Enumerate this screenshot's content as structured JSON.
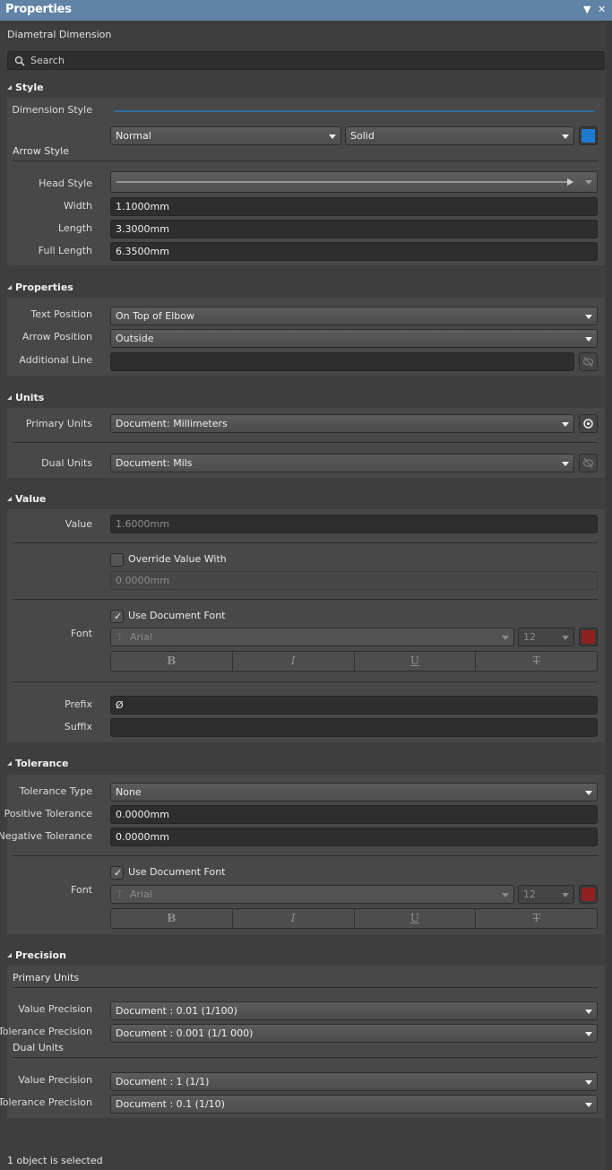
{
  "window": {
    "title": "Properties",
    "menu_icon": "dropdown-triangle-icon",
    "close_icon": "close-icon"
  },
  "object_type": "Diametral Dimension",
  "search": {
    "placeholder": "Search",
    "value": ""
  },
  "sections": {
    "style": {
      "header": "Style",
      "dimension_style_label": "Dimension Style",
      "line_color": "#2f6f9f",
      "line_type": "Normal",
      "line_pattern": "Solid",
      "color_swatch": "#1c7bd0",
      "arrow_style_header": "Arrow Style",
      "head_style_label": "Head Style",
      "width_label": "Width",
      "width_value": "1.1000mm",
      "length_label": "Length",
      "length_value": "3.3000mm",
      "full_length_label": "Full Length",
      "full_length_value": "6.3500mm"
    },
    "properties": {
      "header": "Properties",
      "text_position_label": "Text Position",
      "text_position_value": "On Top of Elbow",
      "arrow_position_label": "Arrow Position",
      "arrow_position_value": "Outside",
      "additional_line_label": "Additional Line",
      "additional_line_value": ""
    },
    "units": {
      "header": "Units",
      "primary_units_label": "Primary Units",
      "primary_units_value": "Document: Millimeters",
      "dual_units_label": "Dual Units",
      "dual_units_value": "Document: Mils"
    },
    "value": {
      "header": "Value",
      "value_label": "Value",
      "value_value": "1.6000mm",
      "override_label": "Override Value With",
      "override_checked": false,
      "override_value": "0.0000mm",
      "use_doc_font_label": "Use Document Font",
      "use_doc_font_checked": true,
      "font_label": "Font",
      "font_name": "Arial",
      "font_size": "12",
      "font_color": "#8f2020",
      "bold_label": "B",
      "italic_label": "I",
      "underline_label": "U",
      "strike_label": "T",
      "prefix_label": "Prefix",
      "prefix_value": "Ø",
      "suffix_label": "Suffix",
      "suffix_value": ""
    },
    "tolerance": {
      "header": "Tolerance",
      "type_label": "Tolerance Type",
      "type_value": "None",
      "positive_label": "Positive Tolerance",
      "positive_value": "0.0000mm",
      "negative_label": "Negative Tolerance",
      "negative_value": "0.0000mm",
      "use_doc_font_label": "Use Document Font",
      "use_doc_font_checked": true,
      "font_label": "Font",
      "font_name": "Arial",
      "font_size": "12",
      "font_color": "#8f2020",
      "bold_label": "B",
      "italic_label": "I",
      "underline_label": "U",
      "strike_label": "T"
    },
    "precision": {
      "header": "Precision",
      "primary_units_header": "Primary Units",
      "primary_value_precision_label": "Value Precision",
      "primary_value_precision_value": "Document : 0.01 (1/100)",
      "primary_tolerance_precision_label": "Tolerance Precision",
      "primary_tolerance_precision_value": "Document : 0.001 (1/1 000)",
      "dual_units_header": "Dual Units",
      "dual_value_precision_label": "Value Precision",
      "dual_value_precision_value": "Document : 1 (1/1)",
      "dual_tolerance_precision_label": "Tolerance Precision",
      "dual_tolerance_precision_value": "Document : 0.1 (1/10)"
    }
  },
  "status": "1 object is selected"
}
